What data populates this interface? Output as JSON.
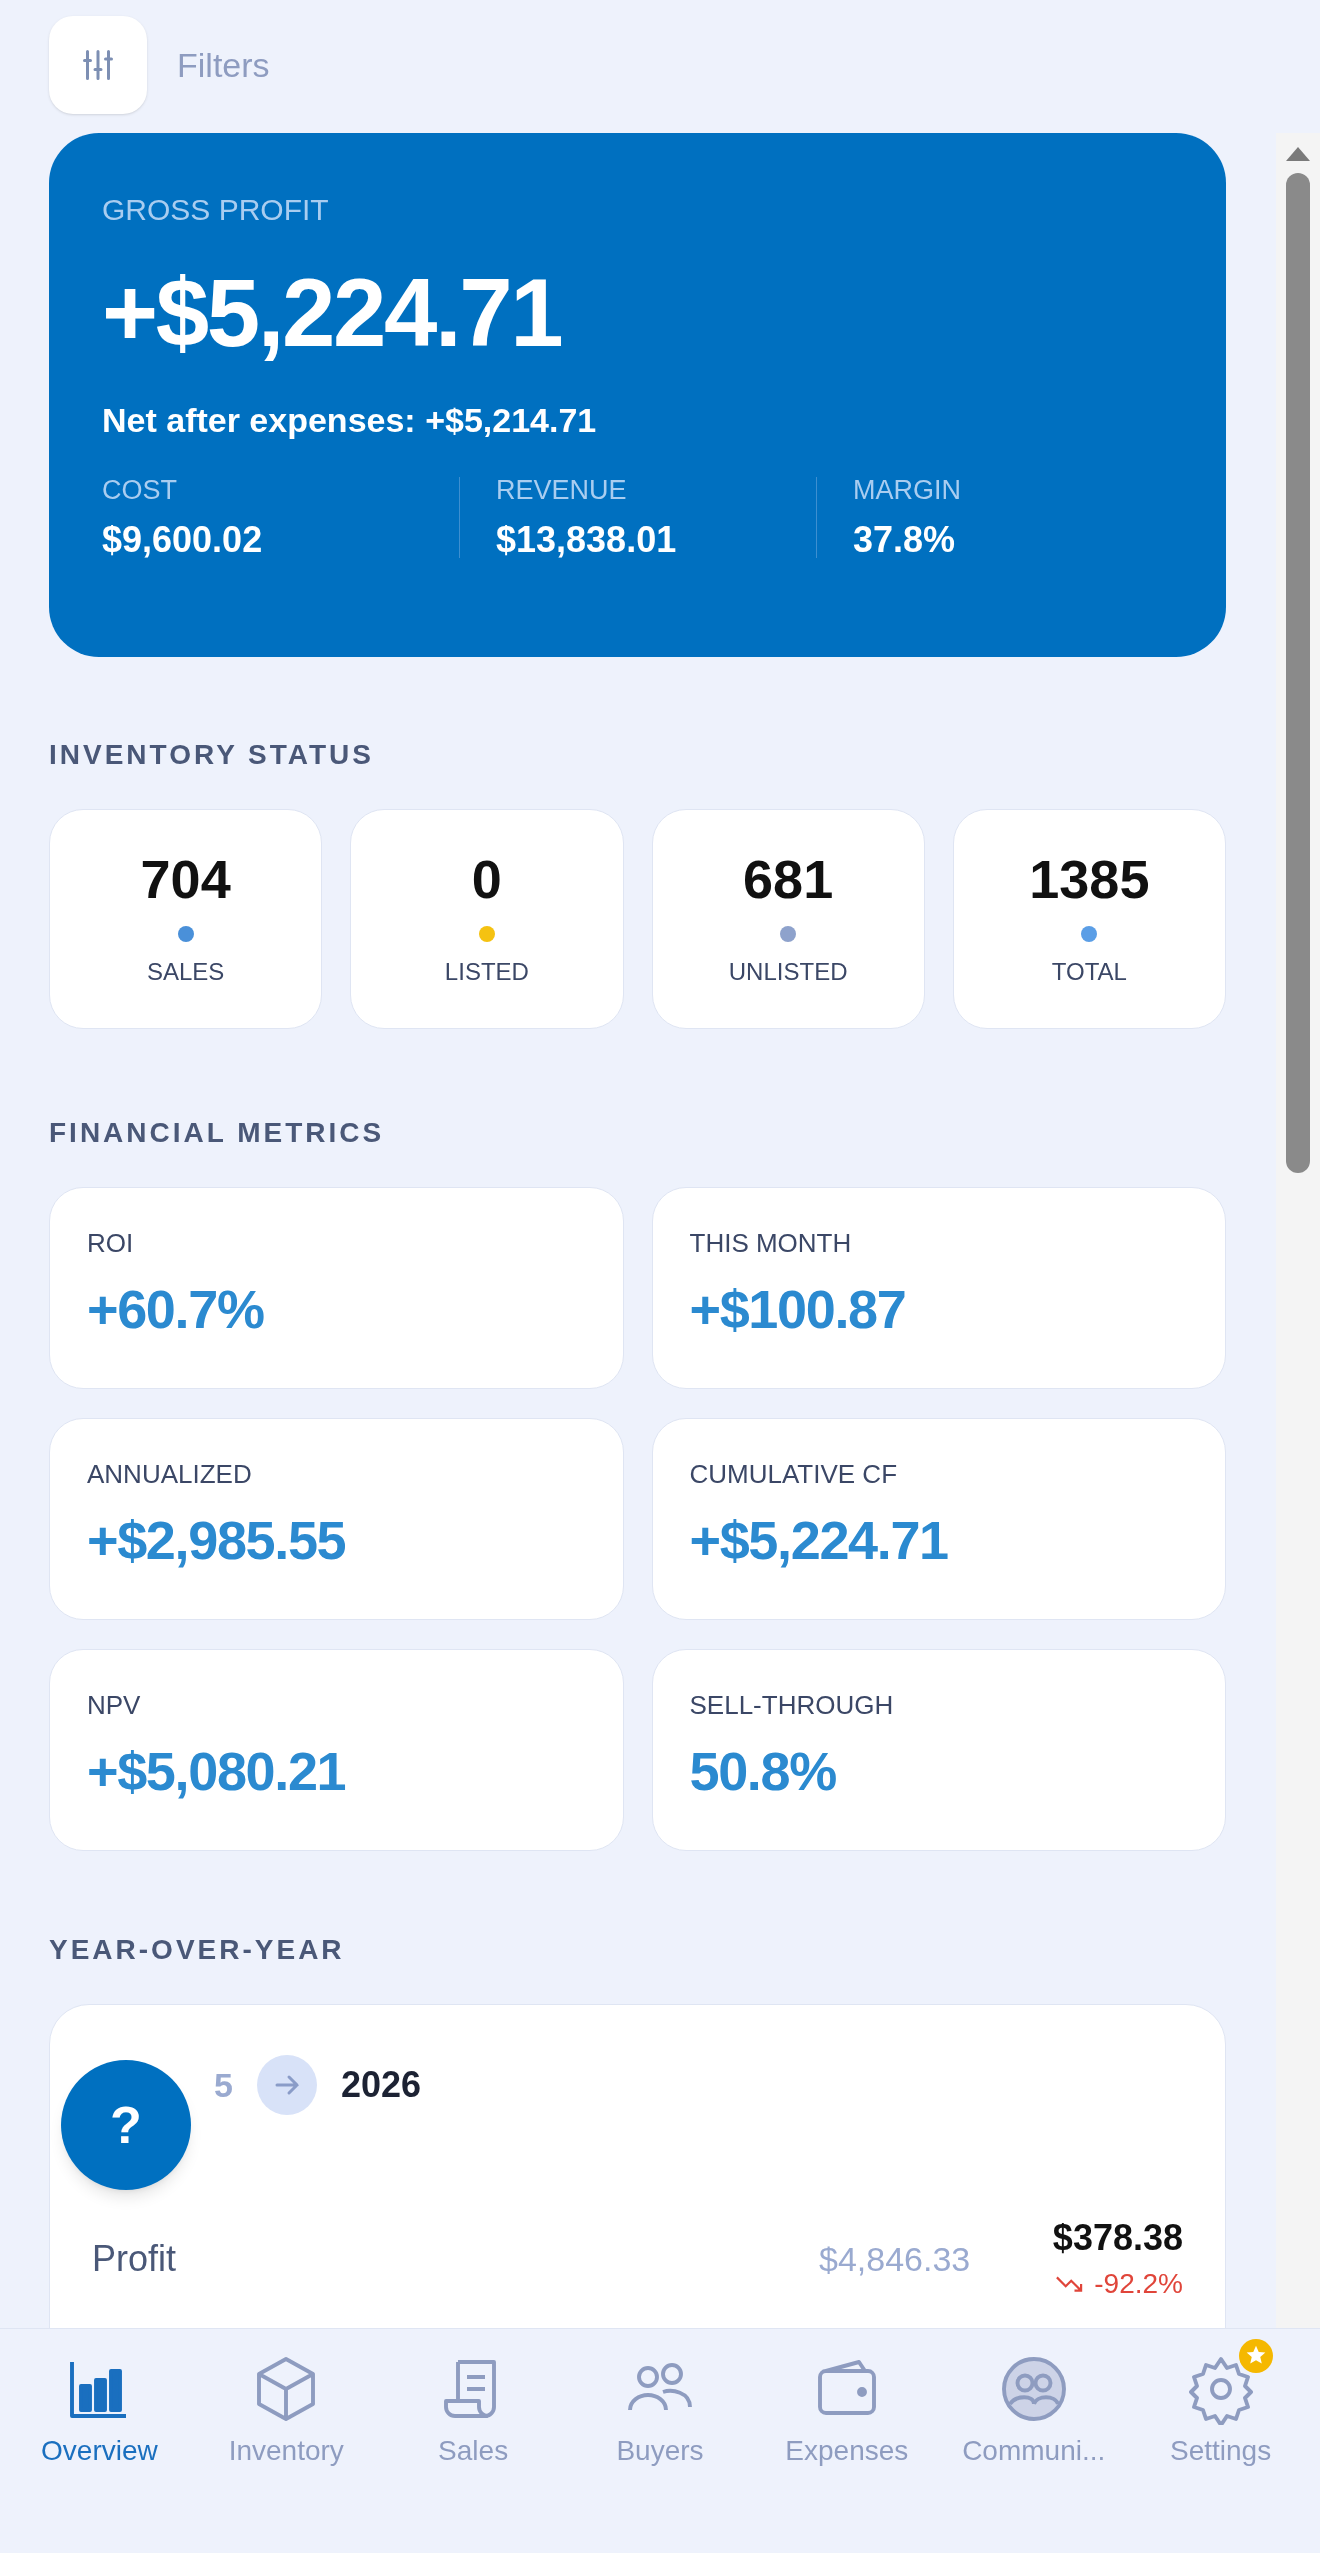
{
  "filters_button": {
    "label": "Filters"
  },
  "gross_profit": {
    "label": "GROSS PROFIT",
    "value": "+$5,224.71",
    "net": "Net after expenses: +$5,214.71",
    "stats": [
      {
        "label": "COST",
        "value": "$9,600.02"
      },
      {
        "label": "REVENUE",
        "value": "$13,838.01"
      },
      {
        "label": "MARGIN",
        "value": "37.8%"
      }
    ]
  },
  "inventory_status": {
    "title": "INVENTORY STATUS",
    "items": [
      {
        "value": "704",
        "label": "SALES",
        "color": "#4a90d9"
      },
      {
        "value": "0",
        "label": "LISTED",
        "color": "#f5c211"
      },
      {
        "value": "681",
        "label": "UNLISTED",
        "color": "#8ea2cc"
      },
      {
        "value": "1385",
        "label": "TOTAL",
        "color": "#5b9ee6"
      }
    ]
  },
  "financial_metrics": {
    "title": "FINANCIAL METRICS",
    "items": [
      {
        "label": "ROI",
        "value": "+60.7%"
      },
      {
        "label": "THIS MONTH",
        "value": "+$100.87"
      },
      {
        "label": "ANNUALIZED",
        "value": "+$2,985.55"
      },
      {
        "label": "CUMULATIVE CF",
        "value": "+$5,224.71"
      },
      {
        "label": "NPV",
        "value": "+$5,080.21"
      },
      {
        "label": "SELL-THROUGH",
        "value": "50.8%"
      }
    ]
  },
  "year_over_year": {
    "title": "YEAR-OVER-YEAR",
    "from_year": "5",
    "to_year": "2026",
    "rows": [
      {
        "label": "Profit",
        "previous": "$4,846.33",
        "current": "$378.38",
        "change": "-92.2%",
        "kind": "decrease"
      }
    ]
  },
  "help_button": {
    "label": "?"
  },
  "nav": [
    {
      "label": "Overview",
      "kind": "chart",
      "selected": true,
      "badge": false
    },
    {
      "label": "Inventory",
      "kind": "box",
      "selected": false,
      "badge": false
    },
    {
      "label": "Sales",
      "kind": "receipt",
      "selected": false,
      "badge": false
    },
    {
      "label": "Buyers",
      "kind": "people",
      "selected": false,
      "badge": false
    },
    {
      "label": "Expenses",
      "kind": "wallet",
      "selected": false,
      "badge": false
    },
    {
      "label": "Communi...",
      "kind": "community",
      "selected": false,
      "badge": false
    },
    {
      "label": "Settings",
      "kind": "gear",
      "selected": false,
      "badge": true
    }
  ]
}
